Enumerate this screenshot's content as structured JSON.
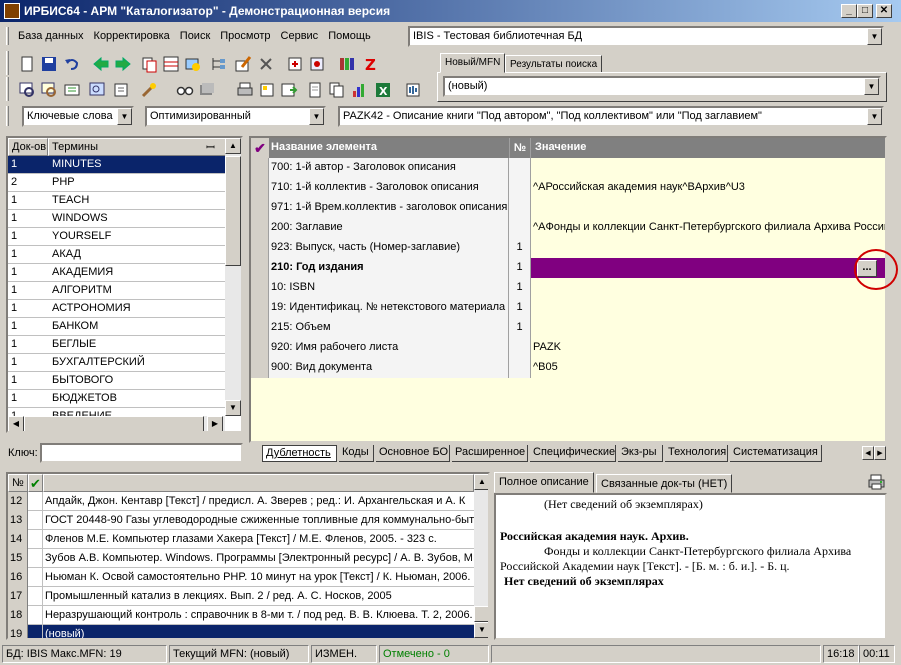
{
  "window": {
    "title": "ИРБИС64 - АРМ \"Каталогизатор\" - Демонстрационная версия",
    "min": "_",
    "max": "□",
    "close": "✕"
  },
  "menu": [
    "База данных",
    "Корректировка",
    "Поиск",
    "Просмотр",
    "Сервис",
    "Помощь"
  ],
  "database_select": "IBIS - Тестовая библиотечная БД",
  "mfn_tabs": [
    "Новый/MFN",
    "Результаты поиска"
  ],
  "mfn_select": "(новый)",
  "search_bar": {
    "mode": "Ключевые слова",
    "optimization": "Оптимизированный",
    "worksheet": "PAZK42 - Описание книги \"Под автором\", \"Под коллективом\" или \"Под заглавием\""
  },
  "terms": {
    "col_docs": "Док-ов",
    "col_terms": "Термины",
    "pin": "ꟷ",
    "rows": [
      {
        "n": "1",
        "t": "MINUTES"
      },
      {
        "n": "2",
        "t": "PHP"
      },
      {
        "n": "1",
        "t": "TEACH"
      },
      {
        "n": "1",
        "t": "WINDOWS"
      },
      {
        "n": "1",
        "t": "YOURSELF"
      },
      {
        "n": "1",
        "t": "АКАД"
      },
      {
        "n": "1",
        "t": "АКАДЕМИЯ"
      },
      {
        "n": "1",
        "t": "АЛГОРИТМ"
      },
      {
        "n": "1",
        "t": "АСТРОНОМИЯ"
      },
      {
        "n": "1",
        "t": "БАНКОМ"
      },
      {
        "n": "1",
        "t": "БЕГЛЫЕ"
      },
      {
        "n": "1",
        "t": "БУХГАЛТЕРСКИЙ"
      },
      {
        "n": "1",
        "t": "БЫТОВОГО"
      },
      {
        "n": "1",
        "t": "БЮДЖЕТОВ"
      },
      {
        "n": "1",
        "t": "ВВЕДЕНИЕ"
      }
    ],
    "key_label": "Ключ:"
  },
  "editor": {
    "col_name": "Название элемента",
    "col_num": "№",
    "col_value": "Значение",
    "rows": [
      {
        "name": "700: 1-й  автор - Заголовок описания",
        "num": "",
        "value": ""
      },
      {
        "name": "710: 1-й коллектив - Заголовок описания",
        "num": "",
        "value": "^AРоссийская академия наук^BАрхив^U3"
      },
      {
        "name": "971: 1-й Врем.коллектив - заголовок описания",
        "num": "",
        "value": ""
      },
      {
        "name": "200: Заглавие",
        "num": "",
        "value": "^AФонды и коллекции Санкт-Петербургского филиала Архива Российс"
      },
      {
        "name": "923: Выпуск, часть (Номер-заглавие)",
        "num": "1",
        "value": ""
      },
      {
        "name": "210: Год издания",
        "num": "1",
        "value": ""
      },
      {
        "name": "10: ISBN",
        "num": "1",
        "value": ""
      },
      {
        "name": "19: Идентификац. № нетекстового материала",
        "num": "1",
        "value": ""
      },
      {
        "name": "215: Объем",
        "num": "1",
        "value": ""
      },
      {
        "name": "920: Имя рабочего листа",
        "num": "",
        "value": "PAZK"
      },
      {
        "name": "900: Вид документа",
        "num": "",
        "value": "^B05"
      }
    ],
    "ellipsis": "...",
    "tabs": [
      "Дублетность",
      "Коды",
      "Основное БО",
      "Расширенное",
      "Специфические",
      "Экз-ры",
      "Технология",
      "Систематизация"
    ]
  },
  "records": {
    "col_num": "№",
    "rows": [
      {
        "n": "12",
        "t": "Апдайк, Джон. Кентавр [Текст] / предисл. А. Зверев ; ред.: И. Архангельская и А. К"
      },
      {
        "n": "13",
        "t": "ГОСТ 20448-90 Газы углеводородные сжиженные топливные для коммунально-быт"
      },
      {
        "n": "14",
        "t": "Фленов М.Е. Компьютер глазами Хакера [Текст] / М.Е. Фленов, 2005. - 323 с."
      },
      {
        "n": "15",
        "t": "Зубов А.В. Компьютер. Windows. Программы [Электронный ресурс] / А. В. Зубов, М"
      },
      {
        "n": "16",
        "t": "Ньюман К. Освой самостоятельно PHP. 10 минут на урок [Текст] / К. Ньюман, 2006."
      },
      {
        "n": "17",
        "t": "Промышленный катализ в лекциях. Вып. 2 / ред. А. С. Носков, 2005"
      },
      {
        "n": "18",
        "t": "Неразрушающий контроль : справочник в 8-ми т. / под ред. В. В. Клюева. Т. 2, 2006."
      },
      {
        "n": "19",
        "t": "(новый)"
      }
    ]
  },
  "description": {
    "tabs": [
      "Полное описание",
      "Связанные док-ты (НЕТ)"
    ],
    "line1": "(Нет сведений об экземплярах)",
    "line2": "Российская академия наук. Архив.",
    "line3": "Фонды и коллекции Санкт-Петербургского филиала Архива",
    "line4": "Российской Академии наук [Текст]. - [Б. м. : б. и.]. - Б. ц.",
    "line5": "Нет сведений об экземплярах"
  },
  "status": {
    "db": "БД: IBIS Макс.MFN: 19",
    "mfn": "Текущий MFN: (новый)",
    "changed": "ИЗМЕН.",
    "marked": "Отмечено - 0",
    "time1": "16:18",
    "time2": "00:11"
  },
  "colors": {
    "selection": "#0a246a",
    "edit_row": "#800080",
    "value_bg": "#ffffe0",
    "marked": "#008000",
    "highlight_circle": "#d00000"
  }
}
